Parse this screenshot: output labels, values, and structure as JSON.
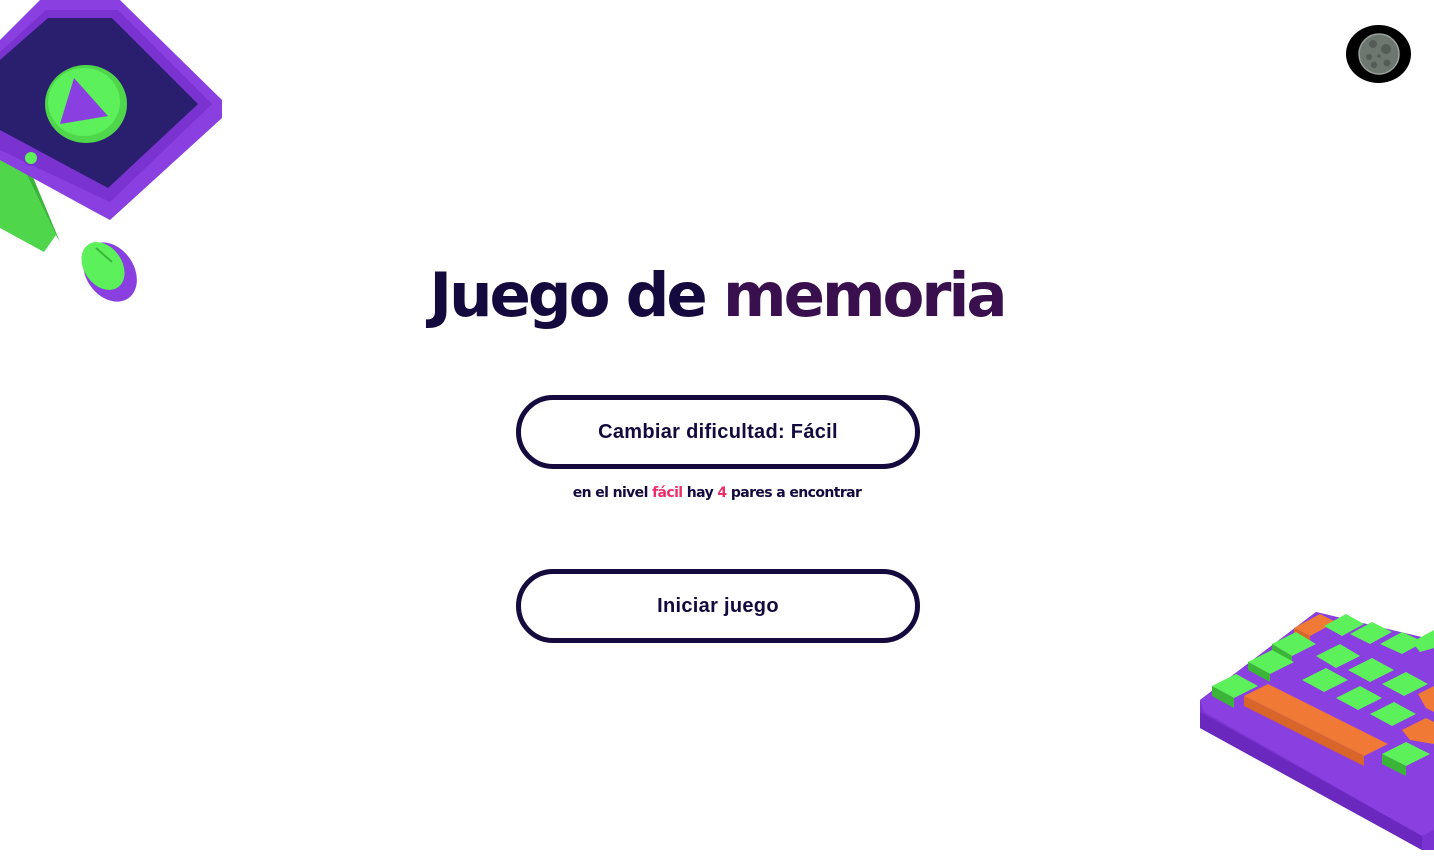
{
  "title": {
    "part1": "Juego de",
    "part2": "memoria"
  },
  "difficulty_button": {
    "label": "Cambiar dificultad: Fácil"
  },
  "hint": {
    "prefix": "en el nivel",
    "level": "fácil",
    "middle": "hay",
    "pairs": "4",
    "suffix": "pares a encontrar"
  },
  "start_button": {
    "label": "Iniciar juego"
  },
  "theme_toggle": {
    "icon": "moon-icon"
  },
  "colors": {
    "ink": "#140a3d",
    "accent_title": "#3a0f4e",
    "highlight": "#f02d6b",
    "purple": "#8a3fe0",
    "green": "#5cf05a",
    "orange": "#f07a35"
  }
}
